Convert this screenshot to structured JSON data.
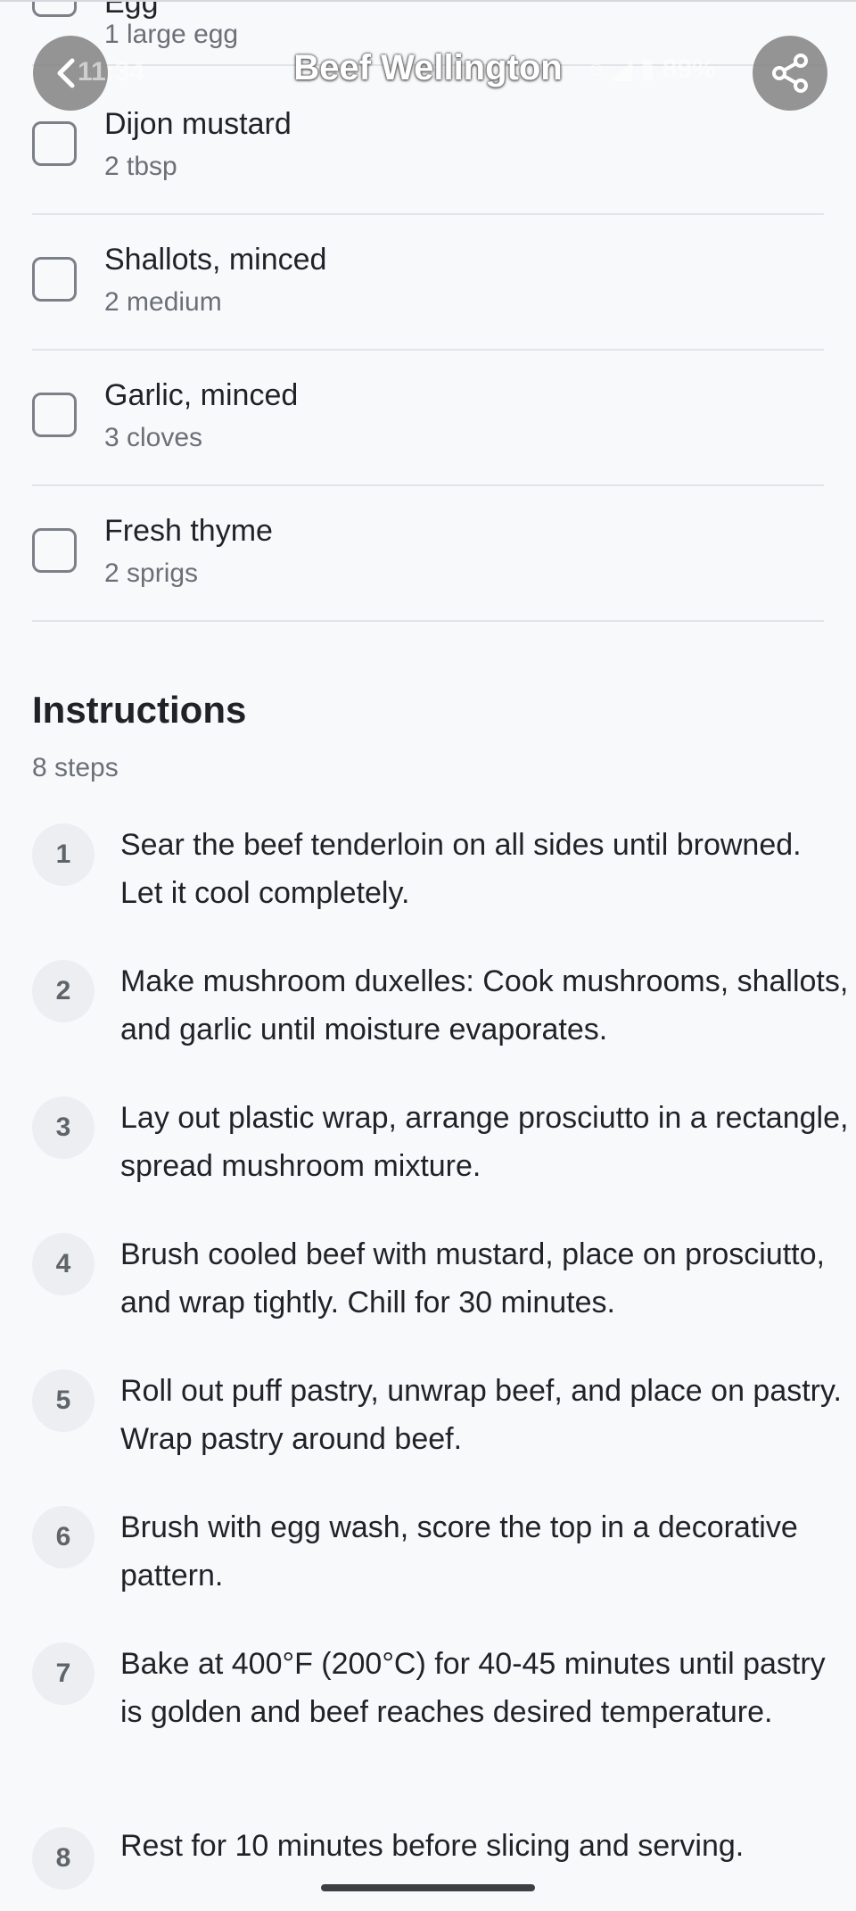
{
  "header": {
    "title": "Beef Wellington",
    "status_time": "11:34",
    "status_battery": "89%",
    "back_icon": "chevron-left-icon",
    "share_icon": "share-icon"
  },
  "ingredients": [
    {
      "name": "Egg",
      "qty": "1 large egg"
    },
    {
      "name": "Dijon mustard",
      "qty": "2 tbsp"
    },
    {
      "name": "Shallots, minced",
      "qty": "2 medium"
    },
    {
      "name": "Garlic, minced",
      "qty": "3 cloves"
    },
    {
      "name": "Fresh thyme",
      "qty": "2 sprigs"
    }
  ],
  "instructions": {
    "title": "Instructions",
    "count_label": "8 steps",
    "steps": [
      {
        "num": "1",
        "text": "Sear the beef tenderloin on all sides until browned. Let it cool completely."
      },
      {
        "num": "2",
        "text": "Make mushroom duxelles: Cook mushrooms, shallots, and garlic until moisture evaporates."
      },
      {
        "num": "3",
        "text": "Lay out plastic wrap, arrange prosciutto in a rectangle, spread mushroom mixture."
      },
      {
        "num": "4",
        "text": "Brush cooled beef with mustard, place on prosciutto, and wrap tightly. Chill for 30 minutes."
      },
      {
        "num": "5",
        "text": "Roll out puff pastry, unwrap beef, and place on pastry. Wrap pastry around beef."
      },
      {
        "num": "6",
        "text": "Brush with egg wash, score the top in a decorative pattern."
      },
      {
        "num": "7",
        "text": "Bake at 400°F (200°C) for 40-45 minutes until pastry is golden and beef reaches desired temperature."
      },
      {
        "num": "8",
        "text": "Rest for 10 minutes before slicing and serving."
      }
    ]
  }
}
